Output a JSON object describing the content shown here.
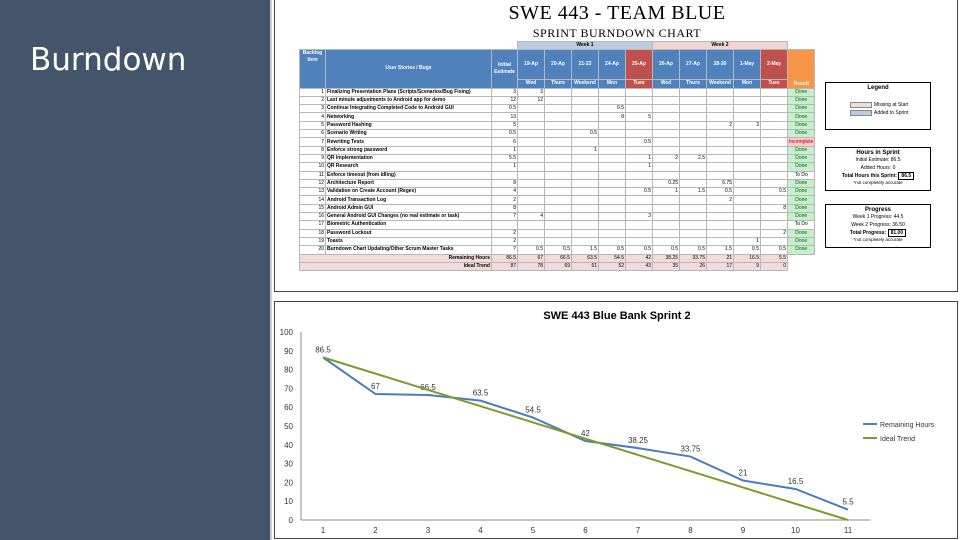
{
  "slide": {
    "title": "Burndown"
  },
  "sheet": {
    "title": "SWE 443 - TEAM BLUE",
    "subtitle": "SPRINT BURNDOWN CHART",
    "header": {
      "backlog_item": "Backlog Item",
      "stories": "User Stories / Bugs",
      "week1": "Week 1",
      "week2": "Week 2",
      "initial_estimate": "Initial Estimate",
      "result": "Result",
      "dates": [
        "19-Ap",
        "20-Ap",
        "21-23",
        "24-Ap",
        "25-Ap",
        "26-Ap",
        "27-Ap",
        "28-30",
        "1-May",
        "2-May"
      ],
      "days": [
        "Wed",
        "Thurs",
        "Weekend",
        "Mon",
        "Tues",
        "Wed",
        "Thurs",
        "Weekend",
        "Mon",
        "Tues"
      ]
    },
    "rows": [
      {
        "id": "1",
        "story": "Finalizing Presentation Plans (Scripts/Scenarios/Bug Fixing)",
        "est": "3",
        "days": [
          "3",
          "",
          "",
          "",
          "",
          "",
          "",
          "",
          "",
          ""
        ],
        "result": "Done"
      },
      {
        "id": "2",
        "story": "Last minute adjustments to Android app for demo",
        "est": "12",
        "days": [
          "12",
          "",
          "",
          "",
          "",
          "",
          "",
          "",
          "",
          ""
        ],
        "result": "Done"
      },
      {
        "id": "3",
        "story": "Continue Integrating Completed Code to Android GUI",
        "est": "0.5",
        "days": [
          "",
          "",
          "",
          "0.5",
          "",
          "",
          "",
          "",
          "",
          ""
        ],
        "result": "Done"
      },
      {
        "id": "4",
        "story": "Networking",
        "est": "13",
        "days": [
          "",
          "",
          "",
          "8",
          "5",
          "",
          "",
          "",
          "",
          ""
        ],
        "result": "Done"
      },
      {
        "id": "5",
        "story": "Password Hashing",
        "est": "5",
        "days": [
          "",
          "",
          "",
          "",
          "",
          "",
          "",
          "2",
          "3",
          ""
        ],
        "result": "Done"
      },
      {
        "id": "6",
        "story": "Scenario Writing",
        "est": "0.5",
        "days": [
          "",
          "",
          "0.5",
          "",
          "",
          "",
          "",
          "",
          "",
          ""
        ],
        "result": "Done"
      },
      {
        "id": "7",
        "story": "Rewriting Tests",
        "est": "6",
        "days": [
          "",
          "",
          "",
          "",
          "0.5",
          "",
          "",
          "",
          "",
          ""
        ],
        "result": "Incomplete"
      },
      {
        "id": "8",
        "story": "Enforce strong password",
        "est": "1",
        "days": [
          "",
          "",
          "1",
          "",
          "",
          "",
          "",
          "",
          "",
          ""
        ],
        "result": "Done"
      },
      {
        "id": "9",
        "story": "QR Implementation",
        "est": "5.5",
        "days": [
          "",
          "",
          "",
          "",
          "1",
          "2",
          "2.5",
          "",
          "",
          ""
        ],
        "result": "Done"
      },
      {
        "id": "10",
        "story": "QR Research",
        "est": "1",
        "days": [
          "",
          "",
          "",
          "",
          "1",
          "",
          "",
          "",
          "",
          ""
        ],
        "result": "Done"
      },
      {
        "id": "11",
        "story": "Enforce timeout (from idling)",
        "est": "",
        "days": [
          "",
          "",
          "",
          "",
          "",
          "",
          "",
          "",
          "",
          ""
        ],
        "result": "To Do"
      },
      {
        "id": "12",
        "story": "Architecture Report",
        "est": "8",
        "days": [
          "",
          "",
          "",
          "",
          "",
          "0.25",
          "",
          "6.75",
          "",
          ""
        ],
        "result": "Done"
      },
      {
        "id": "13",
        "story": "Validation on Create Account (Regex)",
        "est": "4",
        "days": [
          "",
          "",
          "",
          "",
          "0.5",
          "1",
          "1.5",
          "0.5",
          "",
          "0.5"
        ],
        "result": "Done"
      },
      {
        "id": "14",
        "story": "Android Transaction Log",
        "est": "2",
        "days": [
          "",
          "",
          "",
          "",
          "",
          "",
          "",
          "2",
          "",
          ""
        ],
        "result": "Done"
      },
      {
        "id": "15",
        "story": "Android Admin GUI",
        "est": "8",
        "days": [
          "",
          "",
          "",
          "",
          "",
          "",
          "",
          "",
          "",
          "8"
        ],
        "result": "Done"
      },
      {
        "id": "16",
        "story": "General Android GUI Changes (no real estimate or task)",
        "est": "7",
        "days": [
          "4",
          "",
          "",
          "",
          "3",
          "",
          "",
          "",
          "",
          ""
        ],
        "result": "Done"
      },
      {
        "id": "17",
        "story": "Biometric Authentication",
        "est": "",
        "days": [
          "",
          "",
          "",
          "",
          "",
          "",
          "",
          "",
          "",
          ""
        ],
        "result": "To Do"
      },
      {
        "id": "18",
        "story": "Password Lockout",
        "est": "2",
        "days": [
          "",
          "",
          "",
          "",
          "",
          "",
          "",
          "",
          "",
          "2"
        ],
        "result": "Done"
      },
      {
        "id": "19",
        "story": "Toasts",
        "est": "2",
        "days": [
          "",
          "",
          "",
          "",
          "",
          "",
          "",
          "",
          "1",
          ""
        ],
        "result": "Done"
      },
      {
        "id": "20",
        "story": "Burndown Chart Updating/Other Scrum Master Tasks",
        "est": "7",
        "days": [
          "0.5",
          "0.5",
          "1.5",
          "0.5",
          "0.5",
          "0.5",
          "0.5",
          "1.5",
          "0.5",
          "0.5"
        ],
        "result": "Done"
      }
    ],
    "remaining_label": "Remaining Hours",
    "remaining": [
      "86.5",
      "67",
      "66.5",
      "63.5",
      "54.5",
      "42",
      "38.25",
      "33.75",
      "21",
      "16.5",
      "5.5"
    ],
    "ideal_label": "Ideal Trend",
    "ideal": [
      "87",
      "78",
      "69",
      "61",
      "52",
      "43",
      "35",
      "26",
      "17",
      "9",
      "0"
    ],
    "legend": {
      "title": "Legend",
      "missing": "Missing at Start",
      "added": "Added to Sprint",
      "missing_color": "#f2dcdb",
      "added_color": "#b8cce4"
    },
    "hours": {
      "title": "Hours in Sprint",
      "initial": "Initial Estimate:",
      "initial_val": "86.5",
      "added": "Added Hours:",
      "added_val": "0",
      "total": "Total Hours this Sprint:",
      "total_val": "86.5",
      "note": "*not completely accurate"
    },
    "progress": {
      "title": "Progress",
      "w1": "Week 1 Progress:",
      "w1_val": "44.5",
      "w2": "Week 2 Progress:",
      "w2_val": "36.50",
      "total": "Total Progress:",
      "total_val": "81.00",
      "note": "*not completely accurate"
    }
  },
  "chart_data": {
    "type": "line",
    "title": "SWE 443 Blue Bank Sprint 2",
    "x": [
      1,
      2,
      3,
      4,
      5,
      6,
      7,
      8,
      9,
      10,
      11
    ],
    "ylim": [
      0,
      100
    ],
    "yticks": [
      0,
      10,
      20,
      30,
      40,
      50,
      60,
      70,
      80,
      90,
      100
    ],
    "grid": false,
    "legend_position": "right",
    "series": [
      {
        "name": "Remaining Hours",
        "color": "#4a7ebb",
        "values": [
          86.5,
          67,
          66.5,
          63.5,
          54.5,
          42,
          38.25,
          33.75,
          21,
          16.5,
          5.5
        ],
        "labels": [
          "86.5",
          "67",
          "66.5",
          "63.5",
          "54.5",
          "42",
          "38.25",
          "33.75",
          "21",
          "16.5",
          "5.5"
        ]
      },
      {
        "name": "Ideal Trend",
        "color": "#7e9a2a",
        "values": [
          86.5,
          77.85,
          69.2,
          60.55,
          51.9,
          43.25,
          34.6,
          25.95,
          17.3,
          8.65,
          0
        ]
      }
    ]
  }
}
